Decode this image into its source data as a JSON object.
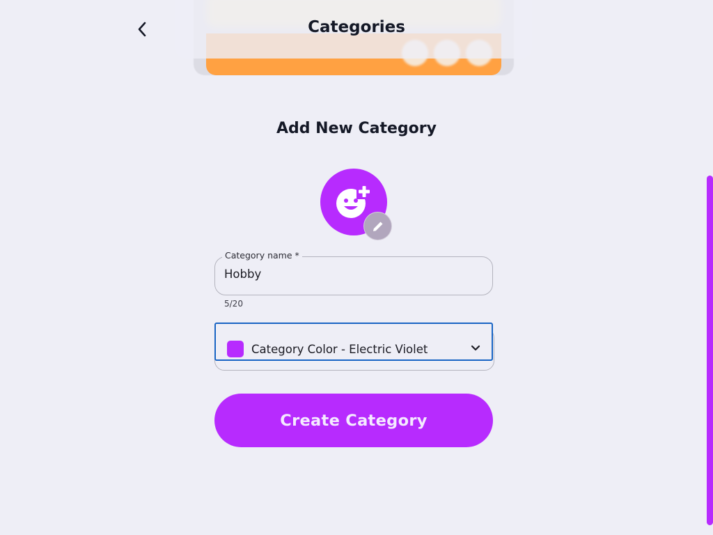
{
  "header": {
    "title": "Categories",
    "back_icon": "chevron-left-icon"
  },
  "form": {
    "heading": "Add New Category",
    "avatar_icon": "add-reaction-icon",
    "edit_icon": "pencil-icon",
    "name_field": {
      "label": "Category name *",
      "value": "Hobby",
      "counter": "5/20"
    },
    "color_select": {
      "selected": "Category Color - Electric Violet",
      "swatch_color": "#b72bfe",
      "icon": "chevron-down-icon"
    },
    "submit_label": "Create Category"
  },
  "colors": {
    "accent": "#b72bfe",
    "focus": "#1864c4",
    "peek_card": "#ffa142"
  }
}
